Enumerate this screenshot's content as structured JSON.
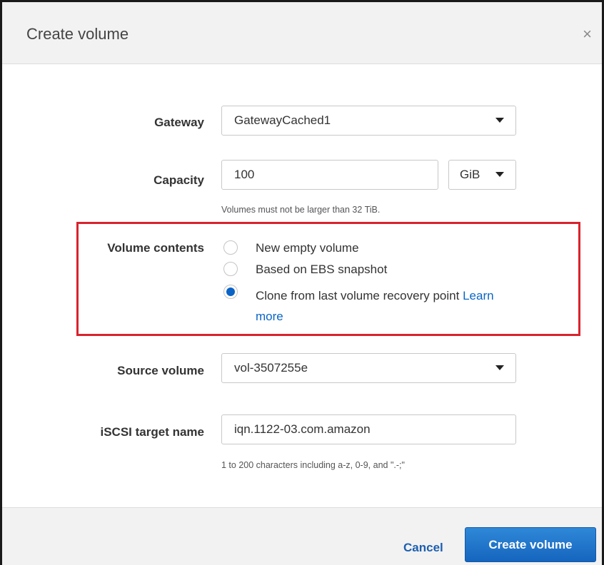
{
  "dialog": {
    "title": "Create volume",
    "close_symbol": "×"
  },
  "form": {
    "gateway": {
      "label": "Gateway",
      "value": "GatewayCached1"
    },
    "capacity": {
      "label": "Capacity",
      "value": "100",
      "unit": "GiB",
      "hint": "Volumes must not be larger than 32 TiB."
    },
    "volume_contents": {
      "label": "Volume contents",
      "options": [
        {
          "label": "New empty volume",
          "checked": false
        },
        {
          "label": "Based on EBS snapshot",
          "checked": false
        },
        {
          "label": "Clone from last volume recovery point",
          "checked": true,
          "link_text_1": "Learn",
          "link_text_2": "more"
        }
      ]
    },
    "source_volume": {
      "label": "Source volume",
      "value": "vol-3507255e"
    },
    "iscsi_target": {
      "label": "iSCSI target name",
      "value": "iqn.1122-03.com.amazon",
      "hint": "1 to 200 characters including a-z, 0-9, and \".-;\""
    }
  },
  "footer": {
    "cancel_label": "Cancel",
    "submit_label": "Create volume"
  },
  "colors": {
    "primary": "#1a6fc9",
    "link": "#0a65c7",
    "highlight_border": "#d9232e"
  }
}
